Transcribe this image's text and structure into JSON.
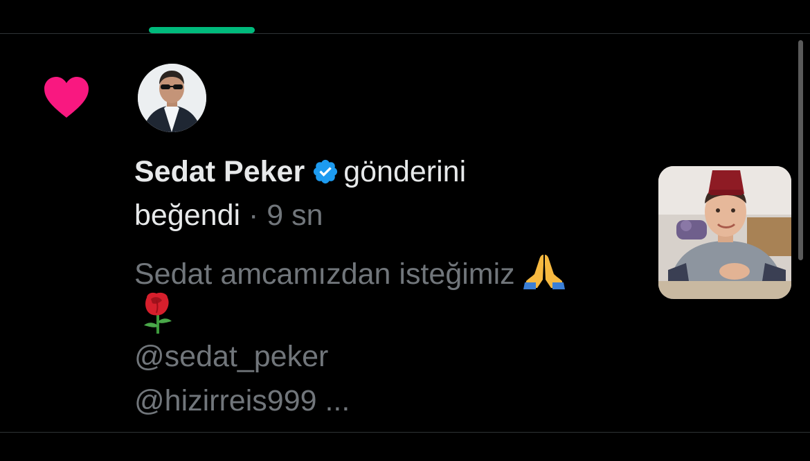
{
  "theme": {
    "accent": "#00ba7c",
    "like": "#f91880",
    "verified": "#1d9bf0",
    "text_primary": "#e7e9ea",
    "text_secondary": "#71767b",
    "divider": "#2f3336"
  },
  "notification": {
    "type_icon": "heart-icon",
    "avatar_icon": "avatar-photo",
    "user_name": "Sedat Peker",
    "verified_icon": "verified-badge-icon",
    "action_part1": "gönderini",
    "action_part2": "beğendi",
    "time": "· 9 sn",
    "tweet": {
      "text_line1": "Sedat amcamızdan isteğimiz",
      "emoji_1": "folded-hands-icon",
      "emoji_2": "rose-icon",
      "mention1": "@sedat_peker",
      "mention2": "@hizirreis999 ..."
    },
    "media_icon": "tweet-photo-thumbnail"
  }
}
